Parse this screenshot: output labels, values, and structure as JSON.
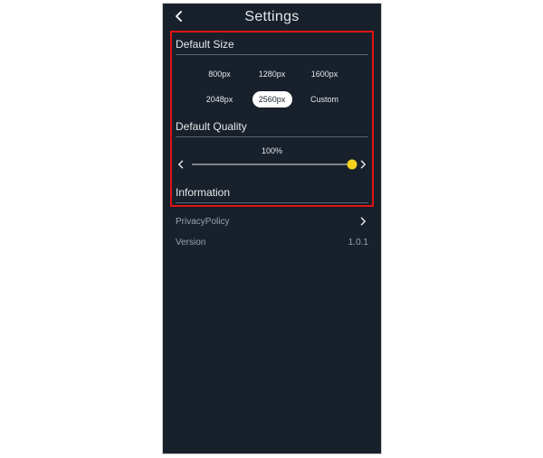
{
  "header": {
    "title": "Settings"
  },
  "defaultSize": {
    "title": "Default Size",
    "options": [
      "800px",
      "1280px",
      "1600px",
      "2048px",
      "2560px",
      "Custom"
    ],
    "selected": "2560px"
  },
  "defaultQuality": {
    "title": "Default Quality",
    "valueLabel": "100%",
    "percent": 100
  },
  "information": {
    "title": "Information",
    "privacyLabel": "PrivacyPolicy",
    "versionLabel": "Version",
    "versionValue": "1.0.1"
  },
  "colors": {
    "highlight": "#e11313",
    "sliderThumb": "#f2d21f"
  }
}
